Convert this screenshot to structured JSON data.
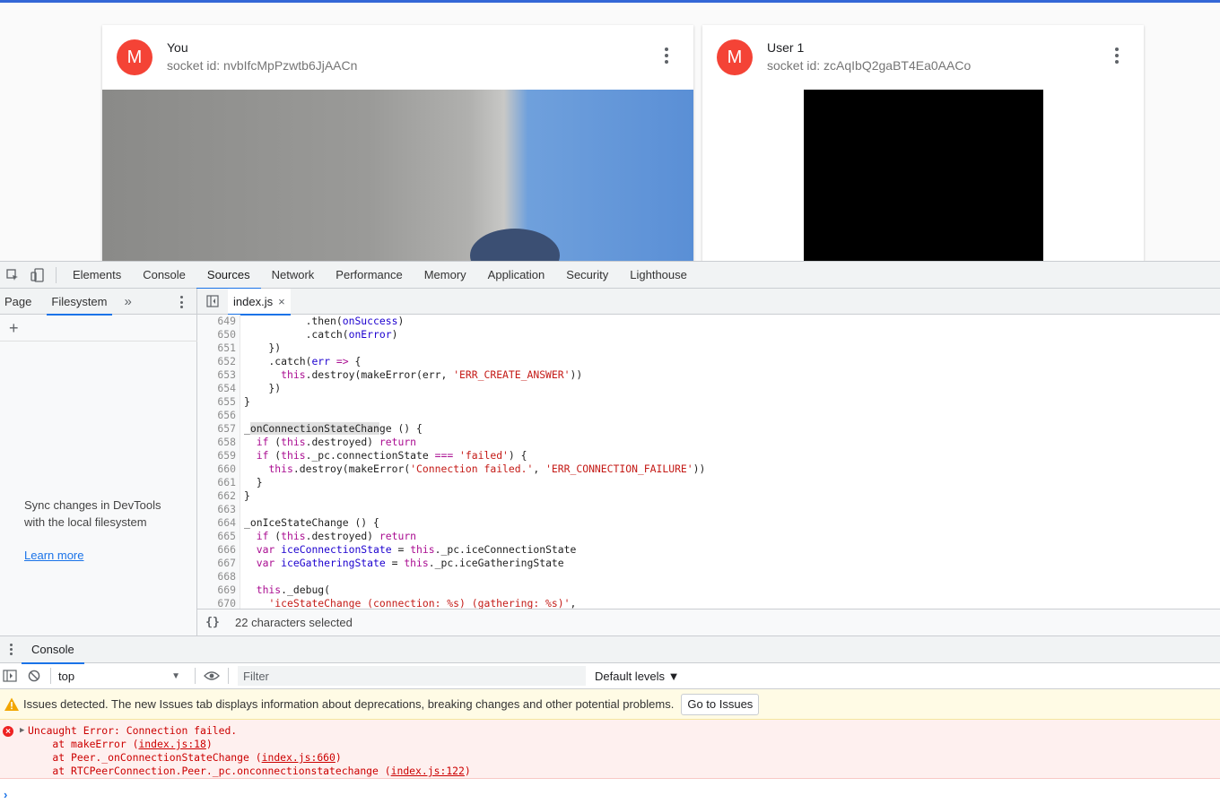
{
  "app": {
    "cards": [
      {
        "avatar": "M",
        "name": "You",
        "socket": "socket id: nvbIfcMpPzwtb6JjAACn"
      },
      {
        "avatar": "M",
        "name": "User 1",
        "socket": "socket id: zcAqIbQ2gaBT4Ea0AACo"
      }
    ]
  },
  "devtools": {
    "tabs": [
      "Elements",
      "Console",
      "Sources",
      "Network",
      "Performance",
      "Memory",
      "Application",
      "Security",
      "Lighthouse"
    ],
    "active_tab": "Sources",
    "navigator": {
      "tabs": [
        "Page",
        "Filesystem"
      ],
      "active": "Filesystem",
      "message": "Sync changes in DevTools with the local filesystem",
      "link": "Learn more"
    },
    "editor": {
      "file": "index.js",
      "close": "×",
      "status": "22 characters selected",
      "braces": "{}"
    },
    "drawer": {
      "tab": "Console",
      "context": "top",
      "filter_placeholder": "Filter",
      "levels": "Default levels ▼",
      "issues_msg": "Issues detected. The new Issues tab displays information about deprecations, breaking changes and other potential problems.",
      "issues_button": "Go to Issues",
      "error_lines": [
        {
          "pre": "Uncaught Error: Connection failed.",
          "link": "",
          "post": ""
        },
        {
          "pre": "    at makeError (",
          "link": "index.js:18",
          "post": ")"
        },
        {
          "pre": "    at Peer._onConnectionStateChange (",
          "link": "index.js:660",
          "post": ")"
        },
        {
          "pre": "    at RTCPeerConnection.Peer._pc.onconnectionstatechange (",
          "link": "index.js:122",
          "post": ")"
        }
      ]
    }
  },
  "code_lines": [
    {
      "n": "649",
      "html": "          .then(<span class=\"fn\">onSuccess</span>)"
    },
    {
      "n": "650",
      "html": "          .catch(<span class=\"fn\">onError</span>)"
    },
    {
      "n": "651",
      "html": "    })"
    },
    {
      "n": "652",
      "html": "    .catch(<span class=\"fn\">err</span> <span class=\"kw\">=></span> {"
    },
    {
      "n": "653",
      "html": "      <span class=\"kw\">this</span>.destroy(makeError(err, <span class=\"str\">'ERR_CREATE_ANSWER'</span>))"
    },
    {
      "n": "654",
      "html": "    })"
    },
    {
      "n": "655",
      "html": "}"
    },
    {
      "n": "656",
      "html": ""
    },
    {
      "n": "657",
      "html": "_<span class=\"sel\">onConnectionStateChan</span>ge () {"
    },
    {
      "n": "658",
      "html": "  <span class=\"kw\">if</span> (<span class=\"kw\">this</span>.destroyed) <span class=\"kw\">return</span>"
    },
    {
      "n": "659",
      "html": "  <span class=\"kw\">if</span> (<span class=\"kw\">this</span>._pc.connectionState <span class=\"kw\">===</span> <span class=\"str\">'failed'</span>) {"
    },
    {
      "n": "660",
      "html": "    <span class=\"kw\">this</span>.destroy(makeError(<span class=\"str\">'Connection failed.'</span>, <span class=\"str\">'ERR_CONNECTION_FAILURE'</span>))"
    },
    {
      "n": "661",
      "html": "  }"
    },
    {
      "n": "662",
      "html": "}"
    },
    {
      "n": "663",
      "html": ""
    },
    {
      "n": "664",
      "html": "_onIceStateChange () {"
    },
    {
      "n": "665",
      "html": "  <span class=\"kw\">if</span> (<span class=\"kw\">this</span>.destroyed) <span class=\"kw\">return</span>"
    },
    {
      "n": "666",
      "html": "  <span class=\"kw\">var</span> <span class=\"fn\">iceConnectionState</span> = <span class=\"kw\">this</span>._pc.iceConnectionState"
    },
    {
      "n": "667",
      "html": "  <span class=\"kw\">var</span> <span class=\"fn\">iceGatheringState</span> = <span class=\"kw\">this</span>._pc.iceGatheringState"
    },
    {
      "n": "668",
      "html": ""
    },
    {
      "n": "669",
      "html": "  <span class=\"kw\">this</span>._debug("
    },
    {
      "n": "670",
      "html": "    <span class=\"str\">'iceStateChange (connection: %s) (gathering: %s)'</span>,"
    }
  ]
}
